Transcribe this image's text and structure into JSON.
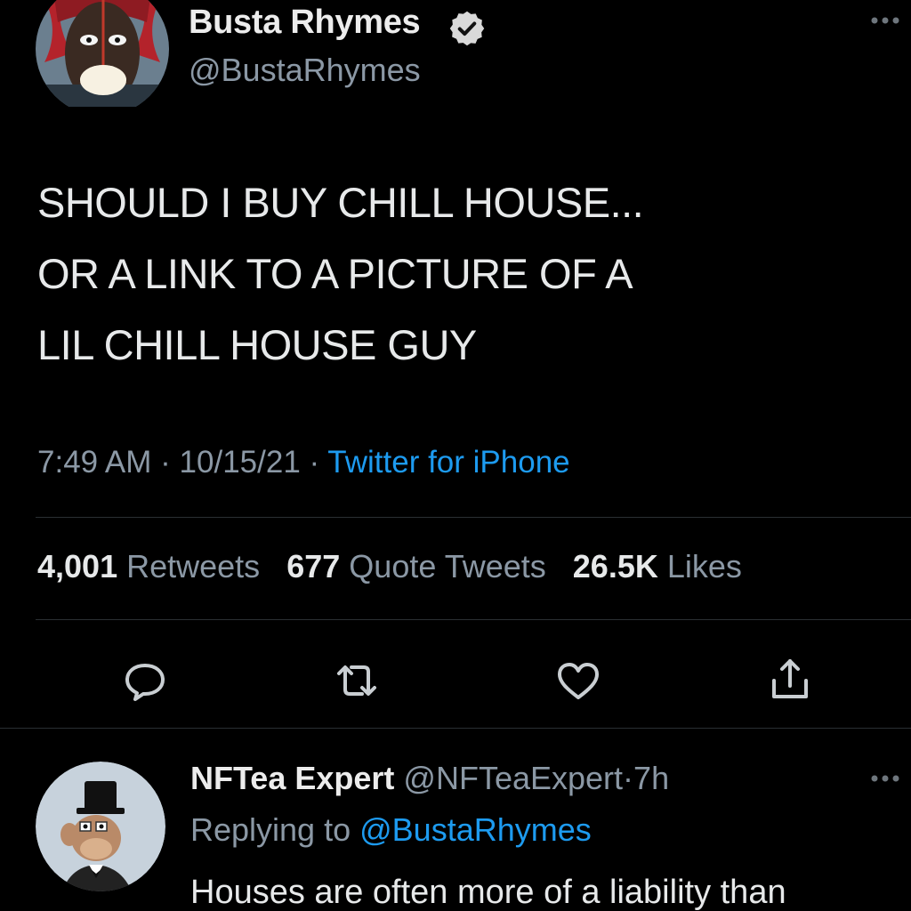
{
  "tweet": {
    "author": {
      "display_name": "Busta Rhymes",
      "handle": "@BustaRhymes",
      "verified": true,
      "avatar_icon": "profile-photo"
    },
    "more_icon": "more-dots-icon",
    "text_lines": [
      "SHOULD I BUY CHILL HOUSE...",
      "OR A LINK TO A PICTURE OF A",
      "LIL CHILL HOUSE GUY"
    ],
    "meta": {
      "time": "7:49 AM",
      "separator": "·",
      "date": "10/15/21",
      "source": "Twitter for iPhone"
    },
    "stats": {
      "retweets_count": "4,001",
      "retweets_label": "Retweets",
      "quotes_count": "677",
      "quotes_label": "Quote Tweets",
      "likes_count": "26.5K",
      "likes_label": "Likes"
    },
    "actions": [
      "reply-icon",
      "retweet-icon",
      "like-icon",
      "share-icon"
    ]
  },
  "reply": {
    "display_name": "NFTea Expert",
    "handle": "@NFTeaExpert",
    "separator": "·",
    "time": "7h",
    "replying_label": "Replying to",
    "replying_to": "@BustaRhymes",
    "text": "Houses are often more of a liability than"
  },
  "colors": {
    "background": "#000000",
    "text_primary": "#e7e9ea",
    "text_secondary": "#8b98a5",
    "accent": "#1d9bf0",
    "divider": "#2a2f33"
  }
}
